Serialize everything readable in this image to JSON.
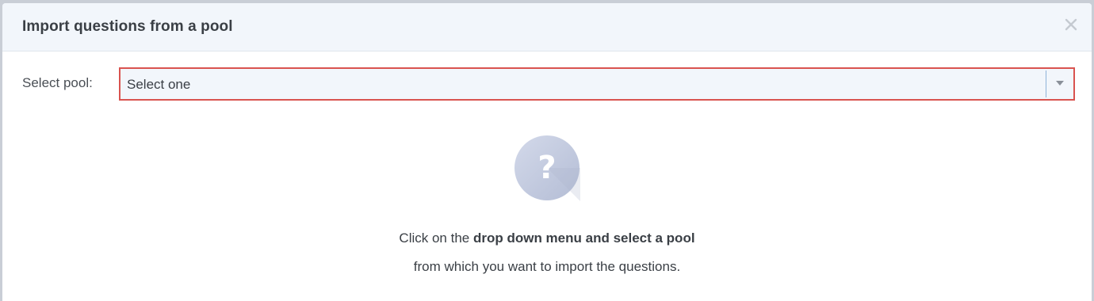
{
  "dialog": {
    "title": "Import questions from a pool",
    "close_icon": "close-icon"
  },
  "form": {
    "pool_label": "Select pool:",
    "pool_select": {
      "selected": "Select one",
      "icon": "chevron-down-icon",
      "border_color": "#d9534f"
    }
  },
  "empty_state": {
    "icon": "question-circle-icon",
    "line1_prefix": "Click on the ",
    "line1_bold": "drop down menu and select a pool",
    "line2": "from which you want to import the questions."
  },
  "colors": {
    "header_bg": "#f2f6fb",
    "accent_error": "#d9534f",
    "icon_bg": "#c3cbe0"
  }
}
